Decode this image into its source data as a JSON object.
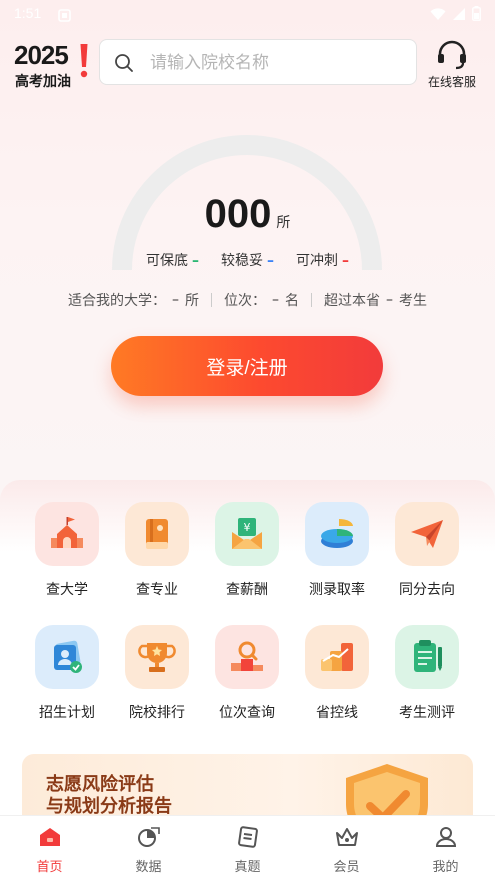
{
  "status": {
    "time": "1:51"
  },
  "header": {
    "logo_year": "2025",
    "logo_subtitle": "高考加油",
    "search_placeholder": "请输入院校名称",
    "customer_service_label": "在线客服"
  },
  "gauge": {
    "count": "000",
    "unit": "所",
    "legend": [
      {
        "label": "可保底",
        "dash": "–",
        "color": "#2bb673"
      },
      {
        "label": "较稳妥",
        "dash": "–",
        "color": "#3b82f6"
      },
      {
        "label": "可冲刺",
        "dash": "–",
        "color": "#f23b3b"
      }
    ]
  },
  "stats": {
    "suitable_label": "适合我的大学：",
    "suitable_value": "–",
    "suitable_unit": "所",
    "rank_label": "位次：",
    "rank_value": "–",
    "rank_unit": "名",
    "exceed_label": "超过本省",
    "exceed_value": "–",
    "exceed_unit": "考生"
  },
  "login_button": "登录/注册",
  "grid": [
    {
      "label": "查大学",
      "icon": "university-icon"
    },
    {
      "label": "查专业",
      "icon": "major-book-icon"
    },
    {
      "label": "查薪酬",
      "icon": "salary-envelope-icon"
    },
    {
      "label": "测录取率",
      "icon": "pie-chart-icon"
    },
    {
      "label": "同分去向",
      "icon": "paper-plane-icon"
    },
    {
      "label": "招生计划",
      "icon": "enrollment-plan-icon"
    },
    {
      "label": "院校排行",
      "icon": "trophy-icon"
    },
    {
      "label": "位次查询",
      "icon": "rank-search-icon"
    },
    {
      "label": "省控线",
      "icon": "bar-chart-icon"
    },
    {
      "label": "考生测评",
      "icon": "clipboard-icon"
    }
  ],
  "banner": {
    "title_line1": "志愿风险评估",
    "title_line2": "与规划分析报告"
  },
  "tabs": [
    {
      "label": "首页",
      "icon": "home-icon",
      "active": true
    },
    {
      "label": "数据",
      "icon": "data-icon",
      "active": false
    },
    {
      "label": "真题",
      "icon": "exam-paper-icon",
      "active": false
    },
    {
      "label": "会员",
      "icon": "crown-icon",
      "active": false
    },
    {
      "label": "我的",
      "icon": "profile-icon",
      "active": false
    }
  ]
}
